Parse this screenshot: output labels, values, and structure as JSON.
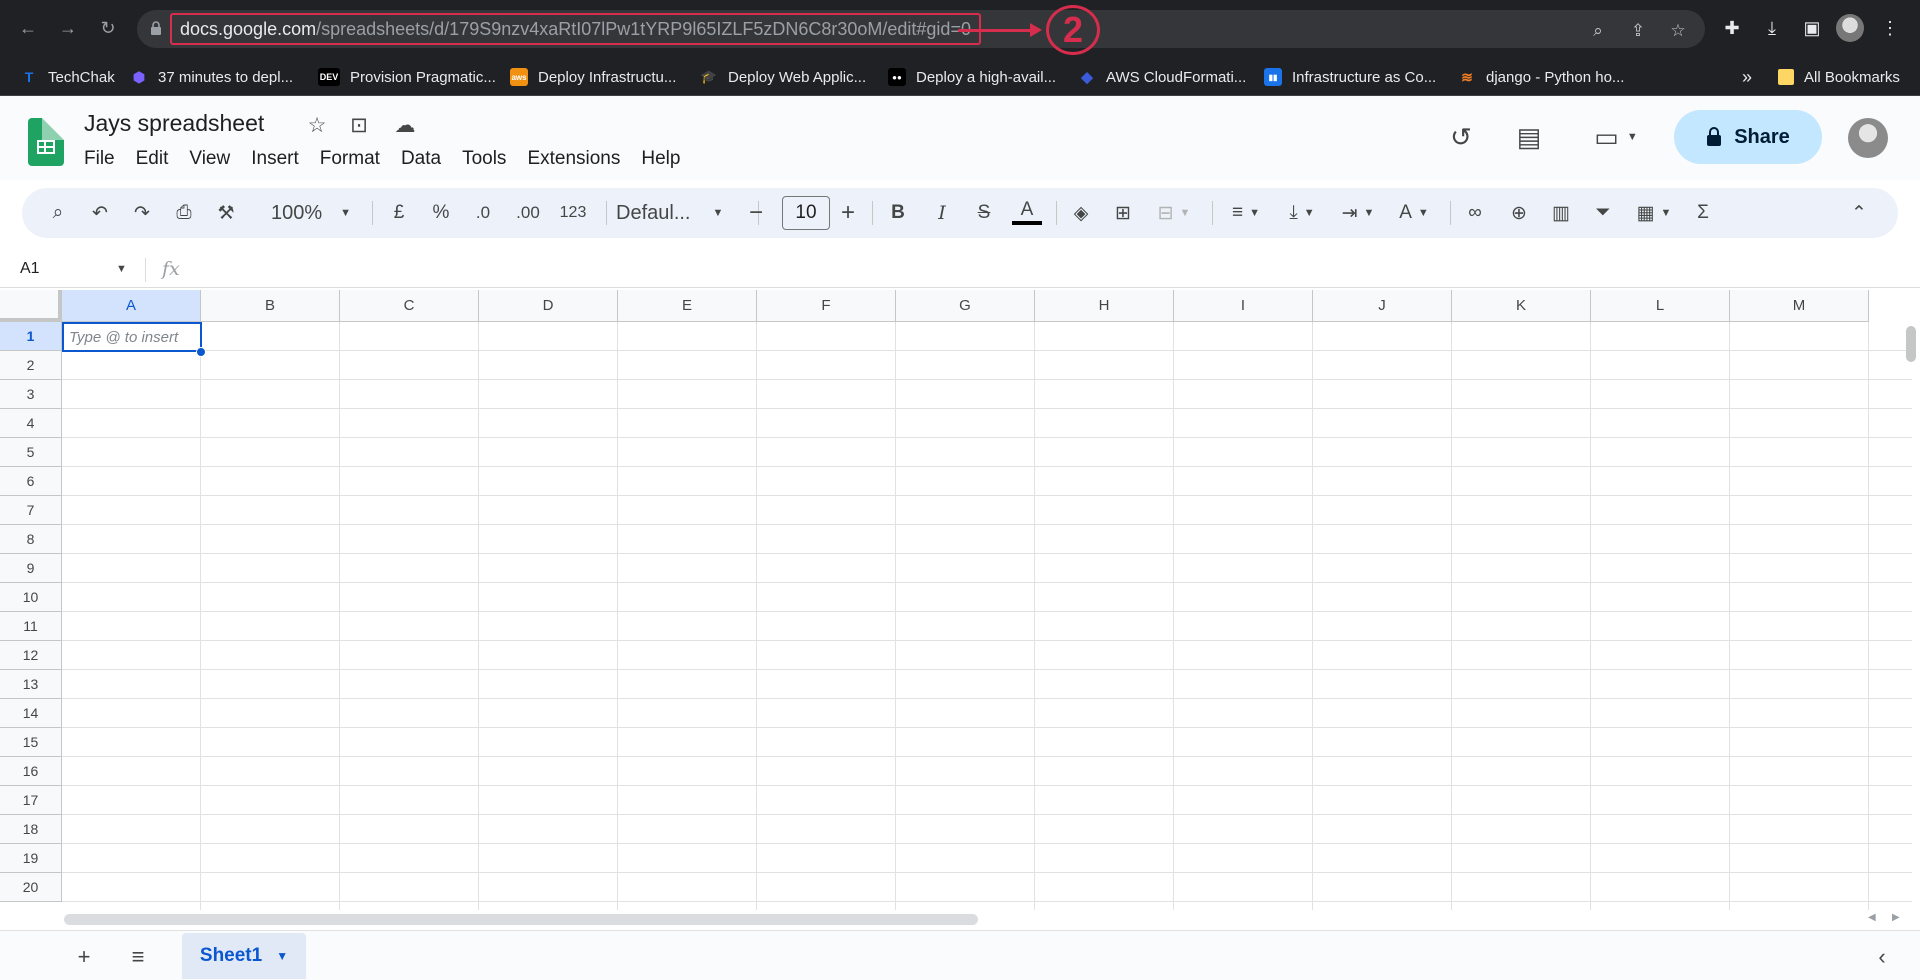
{
  "browser": {
    "url_host": "docs.google.com",
    "url_path": "/spreadsheets/d/179S9nzv4xaRtI07lPw1tYRP9l65IZLF5zDN6C8r30oM/edit#gid=0",
    "annotation_number": "2",
    "bookmarks": [
      {
        "label": "TechChak",
        "icon": "T",
        "color": "#1a73e8"
      },
      {
        "label": "37 minutes to depl...",
        "icon": "⬢",
        "color": "#7b61ff"
      },
      {
        "label": "Provision Pragmatic...",
        "icon": "DEV",
        "color": "#000000"
      },
      {
        "label": "Deploy Infrastructu...",
        "icon": "aws",
        "color": "#f29111"
      },
      {
        "label": "Deploy Web Applic...",
        "icon": "🎓",
        "color": "#202124"
      },
      {
        "label": "Deploy a high-avail...",
        "icon": "●●",
        "color": "#000000"
      },
      {
        "label": "AWS CloudFormati...",
        "icon": "◆",
        "color": "#3b5bdb"
      },
      {
        "label": "Infrastructure as Co...",
        "icon": "▮▮",
        "color": "#1a73e8"
      },
      {
        "label": "django - Python ho...",
        "icon": "≋",
        "color": "#f48024"
      }
    ],
    "overflow": "»",
    "all_bookmarks": "All Bookmarks"
  },
  "sheets": {
    "title": "Jays spreadsheet",
    "menu": [
      "File",
      "Edit",
      "View",
      "Insert",
      "Format",
      "Data",
      "Tools",
      "Extensions",
      "Help"
    ],
    "share_label": "Share",
    "toolbar": {
      "zoom": "100%",
      "currency": "£",
      "percent": "%",
      "dec_decrease": ".0",
      "dec_increase": ".00",
      "number_format": "123",
      "font": "Defaul...",
      "font_size": "10"
    },
    "name_box": "A1",
    "fx": "fx",
    "columns": [
      "A",
      "B",
      "C",
      "D",
      "E",
      "F",
      "G",
      "H",
      "I",
      "J",
      "K",
      "L",
      "M"
    ],
    "rows": [
      "1",
      "2",
      "3",
      "4",
      "5",
      "6",
      "7",
      "8",
      "9",
      "10",
      "11",
      "12",
      "13",
      "14",
      "15",
      "16",
      "17",
      "18",
      "19",
      "20"
    ],
    "active_cell_hint": "Type @ to insert",
    "sheet_tab": "Sheet1"
  }
}
